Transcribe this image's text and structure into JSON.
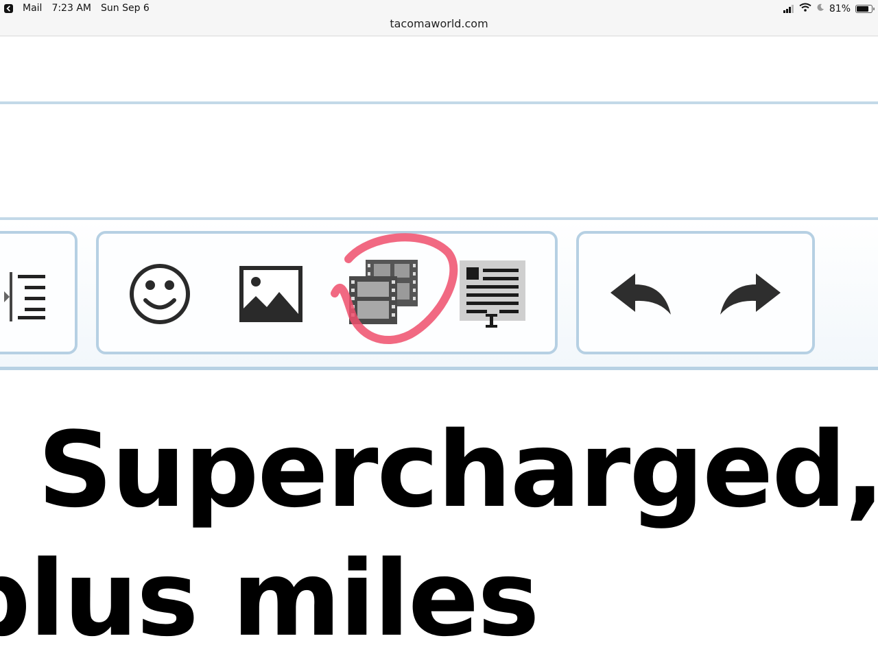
{
  "status_bar": {
    "back_app": "Mail",
    "time": "7:23 AM",
    "date": "Sun Sep 6",
    "battery": "81%",
    "battery_level": 0.81,
    "url": "tacomaworld.com"
  },
  "toolbar": {
    "groups": [
      {
        "name": "alignment",
        "buttons": [
          "indent-icon"
        ]
      },
      {
        "name": "insert",
        "buttons": [
          "smiley-icon",
          "image-icon",
          "media-icon",
          "template-icon"
        ]
      },
      {
        "name": "history",
        "buttons": [
          "undo-icon",
          "redo-icon"
        ]
      }
    ],
    "highlighted_button": "media-icon",
    "colors": {
      "border": "#b6d0e3",
      "highlight": "#ee4f6c"
    }
  },
  "content": {
    "heading_line1": "Supercharged, M",
    "heading_line2": "plus miles"
  }
}
